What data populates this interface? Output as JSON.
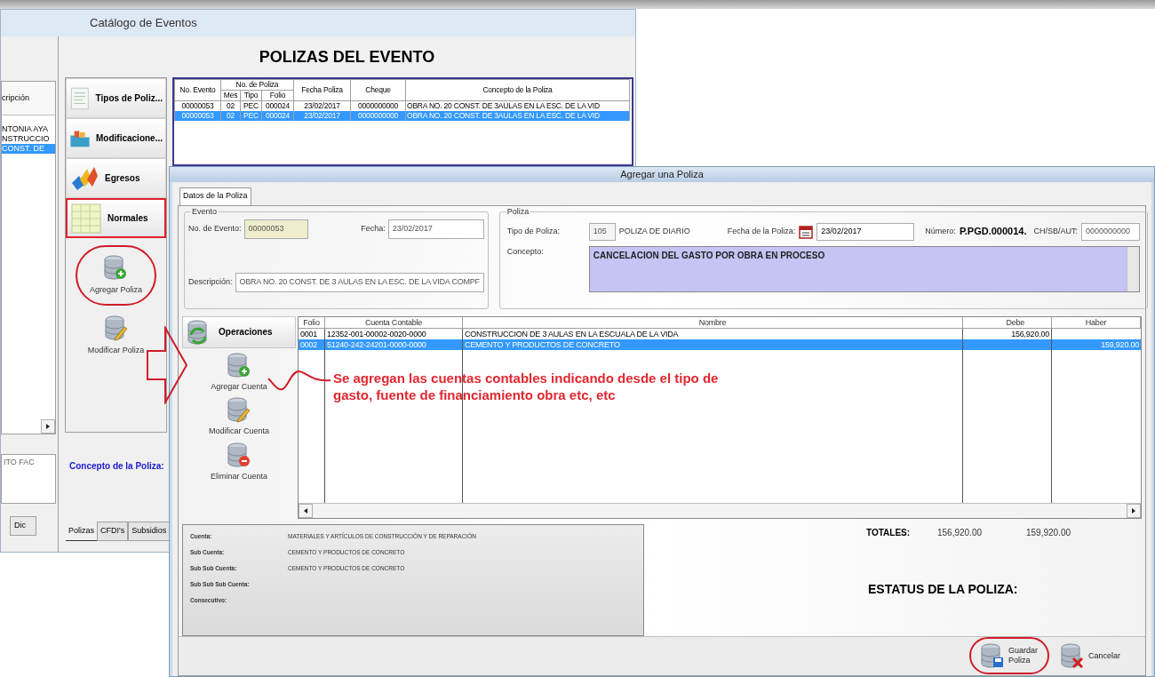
{
  "background_window": {
    "title": "Catálogo de Eventos",
    "list": {
      "header": "cripción",
      "rows": [
        {
          "text": "NTONIA AYA",
          "selected": false
        },
        {
          "text": "NSTRUCCIO",
          "selected": false
        },
        {
          "text": "CONST. DE",
          "selected": true
        }
      ]
    },
    "field": "ITO FAC",
    "left_tabs": [
      {
        "label": "Dic",
        "selected": false
      }
    ],
    "heading": "POLIZAS DEL EVENTO",
    "nav": [
      {
        "label": "Tipos de Poliz...",
        "highlighted": false
      },
      {
        "label": "Modificacione...",
        "highlighted": false
      },
      {
        "label": "Egresos",
        "highlighted": false
      },
      {
        "label": "Normales",
        "highlighted": true
      }
    ],
    "actions": [
      {
        "label": "Agregar Poliza",
        "kind": "add",
        "circled": true
      },
      {
        "label": "Modificar Poliza",
        "kind": "edit",
        "circled": false
      }
    ],
    "table": {
      "group": "No. de Poliza",
      "columns": [
        "No. Evento",
        "Mes",
        "Tipo",
        "Folio",
        "Fecha Poliza",
        "Cheque",
        "Concepto de la Poliza"
      ],
      "rows": [
        {
          "cells": [
            "00000053",
            "02",
            "PEC",
            "000024",
            "23/02/2017",
            "0000000000",
            "OBRA NO. 20 CONST. DE 3AULAS EN LA ESC. DE LA VID"
          ],
          "selected": false
        },
        {
          "cells": [
            "00000053",
            "02",
            "PEC",
            "000024",
            "23/02/2017",
            "0000000000",
            "OBRA NO. 20 CONST. DE 3AULAS EN LA ESC. DE LA VID"
          ],
          "selected": true
        }
      ]
    },
    "concept_label": "Concepto de la Poliza:",
    "tabs": [
      {
        "label": "Polizas",
        "selected": true
      },
      {
        "label": "CFDI's",
        "selected": false
      },
      {
        "label": "Subsidios",
        "selected": false
      }
    ]
  },
  "dialog": {
    "title": "Agregar una Poliza",
    "tabs": [
      {
        "label": "Datos de la Poliza",
        "selected": true
      }
    ],
    "evento": {
      "legend": "Evento",
      "no_label": "No. de Evento:",
      "no_value": "00000053",
      "fecha_label": "Fecha:",
      "fecha_value": "23/02/2017",
      "desc_label": "Descripción:",
      "desc_value": "OBRA NO. 20 CONST. DE 3 AULAS EN LA ESC. DE LA VIDA COMPF"
    },
    "poliza": {
      "legend": "Poliza",
      "tipo_label": "Tipo de Poliza:",
      "tipo_code": "105",
      "tipo_name": "POLIZA DE DIARIO",
      "fecha_label": "Fecha de la Poliza:",
      "fecha_value": "23/02/2017",
      "numero_label": "Número:",
      "numero_value": "P.PGD.000014.",
      "ch_label": "CH/SB/AUT:",
      "ch_value": "0000000000",
      "concepto_label": "Concepto:",
      "concepto_value": "CANCELACION DEL GASTO POR OBRA EN PROCESO"
    },
    "operations": {
      "header": "Operaciones",
      "actions": [
        {
          "label": "Agregar Cuenta",
          "kind": "add"
        },
        {
          "label": "Modificar Cuenta",
          "kind": "edit"
        },
        {
          "label": "Eliminar Cuenta",
          "kind": "remove"
        }
      ]
    },
    "table": {
      "columns": [
        "Folio",
        "Cuenta Contable",
        "Nombre",
        "Debe",
        "Haber"
      ],
      "rows": [
        {
          "folio": "0001",
          "cuenta": "12352-001-00002-0020-0000",
          "nombre": "CONSTRUCCION DE 3 AULAS EN LA ESCUALA DE LA VIDA",
          "debe": "156,920.00",
          "selected": false
        },
        {
          "folio": "0002",
          "cuenta": "51240-242-24201-0000-0000",
          "nombre": "CEMENTO Y PRODUCTOS DE CONCRETO",
          "haber": "159,920.00",
          "selected": true
        }
      ]
    },
    "info": [
      {
        "label": "Cuenta:",
        "value": "MATERIALES Y ARTÍCULOS DE CONSTRUCCIÓN Y DE REPARACIÓN"
      },
      {
        "label": "Sub Cuenta:",
        "value": "CEMENTO Y PRODUCTOS DE CONCRETO"
      },
      {
        "label": "Sub Sub Cuenta:",
        "value": "CEMENTO Y PRODUCTOS DE CONCRETO"
      },
      {
        "label": "Sub Sub Sub Cuenta:"
      },
      {
        "label": "Consecutivo:"
      }
    ],
    "totals": {
      "label": "TOTALES:",
      "debe": "156,920.00",
      "haber": "159,920.00"
    },
    "status_label": "ESTATUS DE LA POLIZA:",
    "buttons": [
      {
        "label": "Guardar Poliza",
        "kind": "save",
        "circled": true
      },
      {
        "label": "Cancelar",
        "kind": "cancel",
        "circled": false
      }
    ]
  },
  "annotation": {
    "note": "Se agregan las cuentas contables indicando desde el tipo de gasto, fuente de financiamiento obra etc, etc"
  }
}
